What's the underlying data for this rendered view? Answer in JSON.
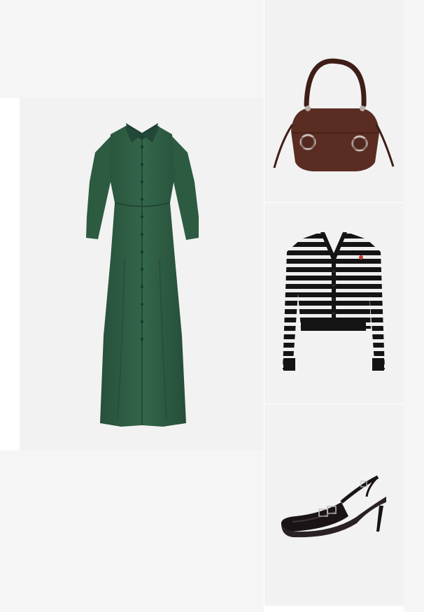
{
  "outfit": {
    "items": [
      {
        "id": "dress",
        "icon": "shirt-dress-image",
        "color": "#2f5e45"
      },
      {
        "id": "bag",
        "icon": "shoulder-bag-image",
        "color": "#5a2c22"
      },
      {
        "id": "cardigan",
        "icon": "striped-cardigan-image",
        "color": "#151515"
      },
      {
        "id": "shoe",
        "icon": "slingback-heel-image",
        "color": "#1a1416"
      }
    ]
  },
  "colors": {
    "page_bg": "#ffffff",
    "card_bg": "#f2f2f2"
  }
}
